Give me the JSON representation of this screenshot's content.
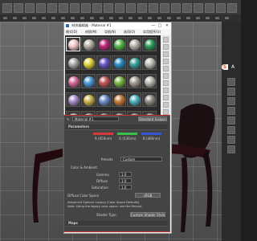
{
  "app": {
    "toolbar_icons": [
      "undo-icon",
      "redo-icon",
      "link-icon",
      "unlink-icon",
      "select-icon",
      "move-icon",
      "rotate-icon",
      "scale-icon",
      "view-icon",
      "snap-icon",
      "angle-snap-icon",
      "percent-snap-icon",
      "mirror-icon",
      "align-icon",
      "layer-icon",
      "curve-icon",
      "schematic-icon",
      "material-editor-icon",
      "render-setup-icon",
      "render-frame-icon",
      "render-icon"
    ]
  },
  "badge": {
    "letter": "S",
    "side_letter": "A",
    "color": "#e8501c"
  },
  "material_editor": {
    "title": "材质编辑器 - Material #1",
    "menu": [
      "模式(D)",
      "材质(M)",
      "导航(N)",
      "选项(O)",
      "实用程序(U)"
    ],
    "window_buttons": {
      "minimize": "—",
      "maximize": "□",
      "close": "✕"
    },
    "slots": [
      {
        "color": "#f2c8c8"
      },
      {
        "color": "#b7b0a8"
      },
      {
        "color": "#c0287a"
      },
      {
        "color": "#56b84a"
      },
      {
        "color": "#b6b2aa"
      },
      {
        "color": "#2f9e5b"
      },
      {
        "color": "#a9a9a9"
      },
      {
        "color": "#e1d23a"
      },
      {
        "color": "#6a58c7"
      },
      {
        "color": "#2a8dc5"
      },
      {
        "color": "#3aa09a"
      },
      {
        "color": "#bfbcb5"
      },
      {
        "color": "#d66a9a"
      },
      {
        "color": "#4d9ad8"
      },
      {
        "color": "#c55858"
      },
      {
        "color": "#7ab745"
      },
      {
        "color": "#a49c90"
      },
      {
        "color": "#b9b6ae"
      },
      {
        "color": "#a88cc8"
      },
      {
        "color": "#c8b24a"
      },
      {
        "color": "#6c8fce"
      },
      {
        "color": "#c57b3a"
      },
      {
        "color": "#50b0c0"
      },
      {
        "color": "#8f8a80"
      },
      {
        "color": "#9a9a9a"
      },
      {
        "color": "#888888"
      },
      {
        "color": "#7f7f7f"
      },
      {
        "color": "#8a8a8a"
      },
      {
        "color": "#858585"
      },
      {
        "color": "#808080"
      }
    ],
    "material_row": {
      "picker": "Material #1",
      "type_button": "Standard (Legacy)"
    },
    "parameters": {
      "rollout": "Parameters",
      "wavelength_labels": [
        "R (650nm)",
        "G (530nm)",
        "B (460nm)"
      ],
      "swatch_colors": [
        "#d43a3a",
        "#3bbf4a",
        "#3a55d4"
      ],
      "preset_label": "Presets",
      "preset_value": "Custom",
      "color_section": "Color & Ambient",
      "fields": [
        {
          "label": "Gamma",
          "value": "1.0"
        },
        {
          "label": "Diffuse",
          "value": "1.0"
        },
        {
          "label": "Saturation",
          "value": "1.0"
        }
      ],
      "render_label": "Diffuse Color Space",
      "render_button": "sRGB",
      "notes": [
        "Advanced Options: Legacy (Color Space Defaults)",
        "Note: Using the legacy color space, see the Manual."
      ],
      "footer_label": "Shader Type:",
      "footer_button": "Custom Shader Style",
      "bottom_rollout": "Maps"
    }
  }
}
